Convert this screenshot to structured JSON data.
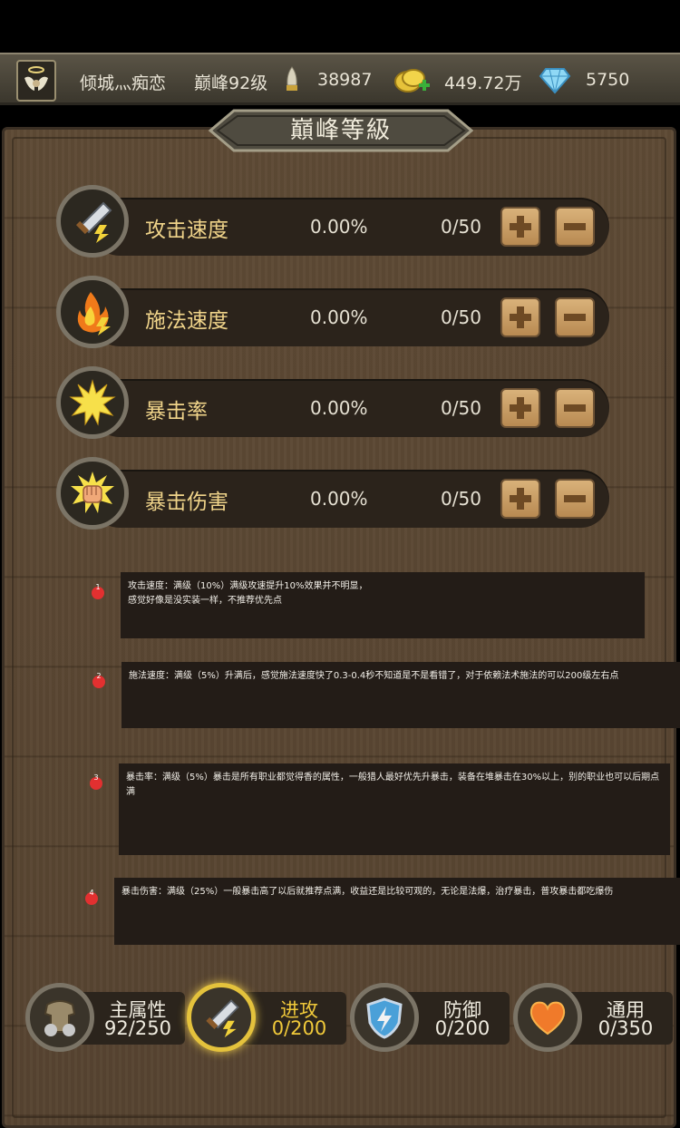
{
  "top_bar": {
    "player_name": "倾城灬痴恋",
    "peak_level": "巅峰92级",
    "resource1": "38987",
    "gold": "449.72万",
    "diamond": "5750"
  },
  "title": "巔峰等級",
  "attributes": [
    {
      "name": "攻击速度",
      "percent": "0.00%",
      "count": "0/50",
      "icon": "sword-lightning-icon"
    },
    {
      "name": "施法速度",
      "percent": "0.00%",
      "count": "0/50",
      "icon": "fire-lightning-icon"
    },
    {
      "name": "暴击率",
      "percent": "0.00%",
      "count": "0/50",
      "icon": "burst-icon"
    },
    {
      "name": "暴击伤害",
      "percent": "0.00%",
      "count": "0/50",
      "icon": "fist-burst-icon"
    }
  ],
  "notes": [
    {
      "num": "1",
      "text": "攻击速度：满级（10%）满级攻速提升10%效果并不明显，\n感觉好像是没实装一样，不推荐优先点"
    },
    {
      "num": "2",
      "text": "施法速度：满级（5%）升满后，感觉施法速度快了0.3-0.4秒不知道是不是看错了，对于依赖法术施法的可以200级左右点"
    },
    {
      "num": "3",
      "text": "暴击率：满级（5%）暴击是所有职业都觉得香的属性，一般猎人最好优先升暴击，装备在堆暴击在30%以上，别的职业也可以后期点满"
    },
    {
      "num": "4",
      "text": "暴击伤害：满级（25%）一般暴击高了以后就推荐点满，收益还是比较可观的，无论是法爆，治疗暴击，普攻暴击都吃爆伤"
    }
  ],
  "tabs": [
    {
      "label": "主属性",
      "value": "92/250",
      "icon": "armor-icon",
      "active": false
    },
    {
      "label": "进攻",
      "value": "0/200",
      "icon": "sword-lightning-icon",
      "active": true
    },
    {
      "label": "防御",
      "value": "0/200",
      "icon": "shield-lightning-icon",
      "active": false
    },
    {
      "label": "通用",
      "value": "0/350",
      "icon": "heart-icon",
      "active": false
    }
  ],
  "colors": {
    "accent_gold": "#f0c93a",
    "attr_name": "#f0d48a",
    "wood": "#5e4a35",
    "note_dot": "#e23030"
  }
}
